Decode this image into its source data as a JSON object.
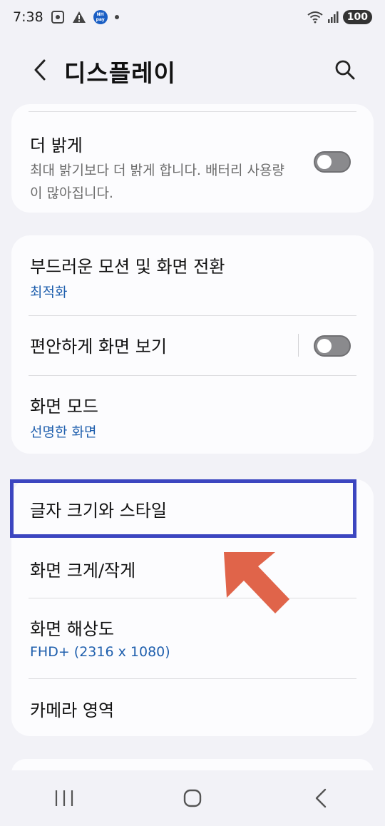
{
  "status_bar": {
    "time": "7:38",
    "left_icons": [
      "screenshot-icon",
      "warning-icon",
      "nh-pay-icon",
      "notification-dot-icon"
    ],
    "nh_pay_line1": "NH",
    "nh_pay_line2": "pay",
    "battery": "100"
  },
  "header": {
    "title": "디스플레이"
  },
  "card1": {
    "extra_dim": {
      "title": "더 밝게",
      "description": "최대 밝기보다 더 밝게 합니다. 배터리 사용량이 많아집니다.",
      "toggle_on": false
    }
  },
  "card2": {
    "motion": {
      "title": "부드러운 모션 및 화면 전환",
      "value": "최적화"
    },
    "eye_comfort": {
      "title": "편안하게 화면 보기",
      "toggle_on": false
    },
    "screen_mode": {
      "title": "화면 모드",
      "value": "선명한 화면"
    }
  },
  "card3": {
    "font": {
      "title": "글자 크기와 스타일"
    },
    "zoom": {
      "title": "화면 크게/작게"
    },
    "resolution": {
      "title": "화면 해상도",
      "value": "FHD+ (2316 x 1080)"
    },
    "camera_cutout": {
      "title": "카메라 영역"
    }
  },
  "annotation": {
    "highlight_color": "#3c46c0",
    "arrow_color": "#e0644a"
  },
  "colors": {
    "accent_value": "#1f5fad",
    "background": "#f2f2f7"
  }
}
